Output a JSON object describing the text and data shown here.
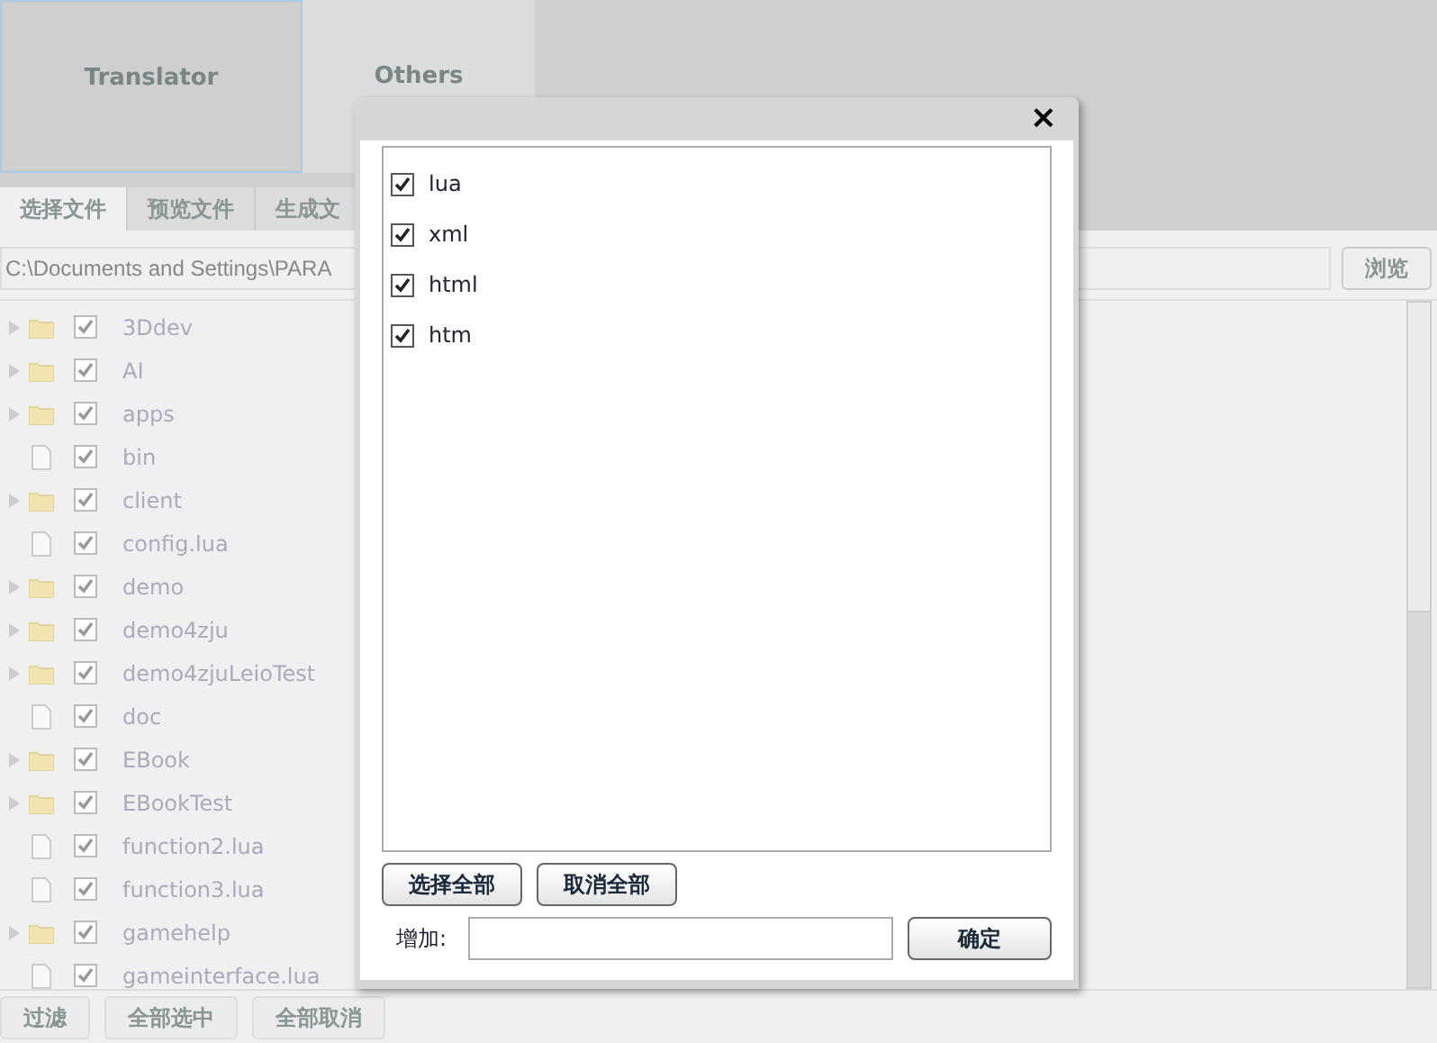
{
  "top_tabs": [
    {
      "label": "Translator",
      "selected": true
    },
    {
      "label": "Others",
      "selected": false
    }
  ],
  "tabs": [
    {
      "label": "选择文件",
      "selected": true
    },
    {
      "label": "预览文件",
      "selected": false
    },
    {
      "label": "生成文",
      "selected": false
    }
  ],
  "path_field": {
    "value": "C:\\Documents and Settings\\PARA"
  },
  "browse_button": "浏览",
  "files": [
    {
      "name": "3Ddev",
      "kind": "folder",
      "checked": true
    },
    {
      "name": "AI",
      "kind": "folder",
      "checked": true
    },
    {
      "name": "apps",
      "kind": "folder",
      "checked": true
    },
    {
      "name": "bin",
      "kind": "file",
      "checked": true
    },
    {
      "name": "client",
      "kind": "folder",
      "checked": true
    },
    {
      "name": "config.lua",
      "kind": "file",
      "checked": true
    },
    {
      "name": "demo",
      "kind": "folder",
      "checked": true
    },
    {
      "name": "demo4zju",
      "kind": "folder",
      "checked": true
    },
    {
      "name": "demo4zjuLeioTest",
      "kind": "folder",
      "checked": true
    },
    {
      "name": "doc",
      "kind": "file",
      "checked": true
    },
    {
      "name": "EBook",
      "kind": "folder",
      "checked": true
    },
    {
      "name": "EBookTest",
      "kind": "folder",
      "checked": true
    },
    {
      "name": "function2.lua",
      "kind": "file",
      "checked": true
    },
    {
      "name": "function3.lua",
      "kind": "file",
      "checked": true
    },
    {
      "name": "gamehelp",
      "kind": "folder",
      "checked": true
    },
    {
      "name": "gameinterface.lua",
      "kind": "file",
      "checked": true
    }
  ],
  "bottom_buttons": [
    "过滤",
    "全部选中",
    "全部取消"
  ],
  "dialog": {
    "close": "×",
    "extensions": [
      {
        "name": "lua",
        "checked": true
      },
      {
        "name": "xml",
        "checked": true
      },
      {
        "name": "html",
        "checked": true
      },
      {
        "name": "htm",
        "checked": true
      }
    ],
    "select_all": "选择全部",
    "deselect_all": "取消全部",
    "add_label": "增加:",
    "ok": "确定"
  }
}
